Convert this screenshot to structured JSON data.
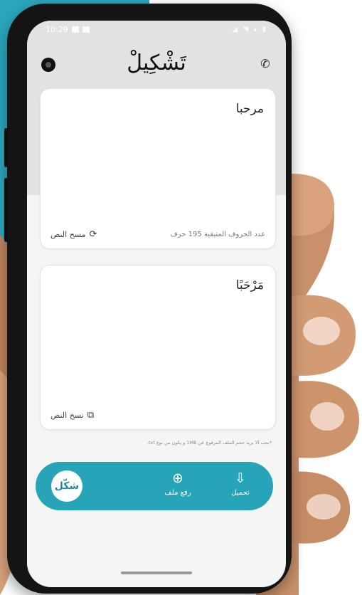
{
  "status_bar": {
    "time": "10:29",
    "icons": "◢ ◥ ▴ ▮"
  },
  "header": {
    "title": "تَشْكِيلْ",
    "theme_icon": "moon-toggle-icon",
    "call_icon": "phone-icon"
  },
  "input_card": {
    "text": "مرحبا",
    "clear_label": "مسح النص",
    "clear_icon": "⟳",
    "char_count": "عدد الحروف المتبقية 195 حرف"
  },
  "output_card": {
    "text": "مَرْحَبًا",
    "copy_label": "نسخ النص",
    "copy_icon": "⧉"
  },
  "note": "*يجب ألا يزيد حجم الملف المرفوع عن 1MB و يكون من نوع txt.",
  "bottom_bar": {
    "tashkeel_label": "شكّل",
    "upload_label": "رفع ملف",
    "upload_icon": "⊕",
    "download_label": "تحميل",
    "download_icon": "⇩"
  },
  "colors": {
    "accent": "#28a4b9",
    "background_teal": "#2aa6bd"
  }
}
